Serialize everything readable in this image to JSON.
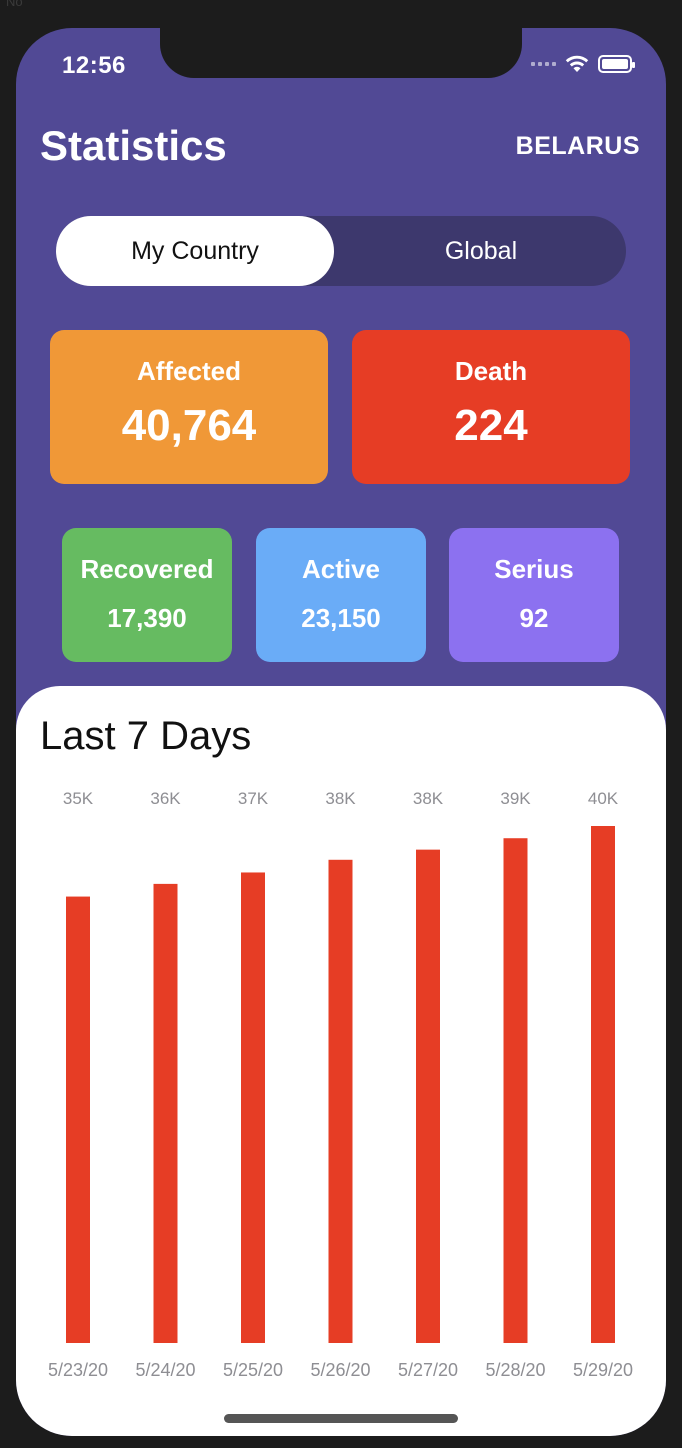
{
  "corner_label": "No",
  "status_bar": {
    "time": "12:56"
  },
  "header": {
    "title": "Statistics",
    "country": "BELARUS"
  },
  "segment": {
    "options": [
      "My Country",
      "Global"
    ],
    "selected": "My Country"
  },
  "stats": {
    "affected": {
      "label": "Affected",
      "value": "40,764"
    },
    "death": {
      "label": "Death",
      "value": "224"
    },
    "recovered": {
      "label": "Recovered",
      "value": "17,390"
    },
    "active": {
      "label": "Active",
      "value": "23,150"
    },
    "serius": {
      "label": "Serius",
      "value": "92"
    }
  },
  "colors": {
    "background": "#514995",
    "affected": "#f09837",
    "death": "#e63d25",
    "recovered": "#66bb61",
    "active": "#6aacf7",
    "serius": "#8c71f0",
    "bar": "#e63d25"
  },
  "panel": {
    "title": "Last 7 Days"
  },
  "chart_data": {
    "type": "bar",
    "title": "Last 7 Days",
    "categories": [
      "5/23/20",
      "5/24/20",
      "5/25/20",
      "5/26/20",
      "5/27/20",
      "5/28/20",
      "5/29/20"
    ],
    "value_labels": [
      "35K",
      "36K",
      "37K",
      "38K",
      "38K",
      "39K",
      "40K"
    ],
    "values": [
      35200,
      36200,
      37100,
      38100,
      38900,
      39800,
      40764
    ],
    "ylim": [
      0,
      40764
    ]
  }
}
